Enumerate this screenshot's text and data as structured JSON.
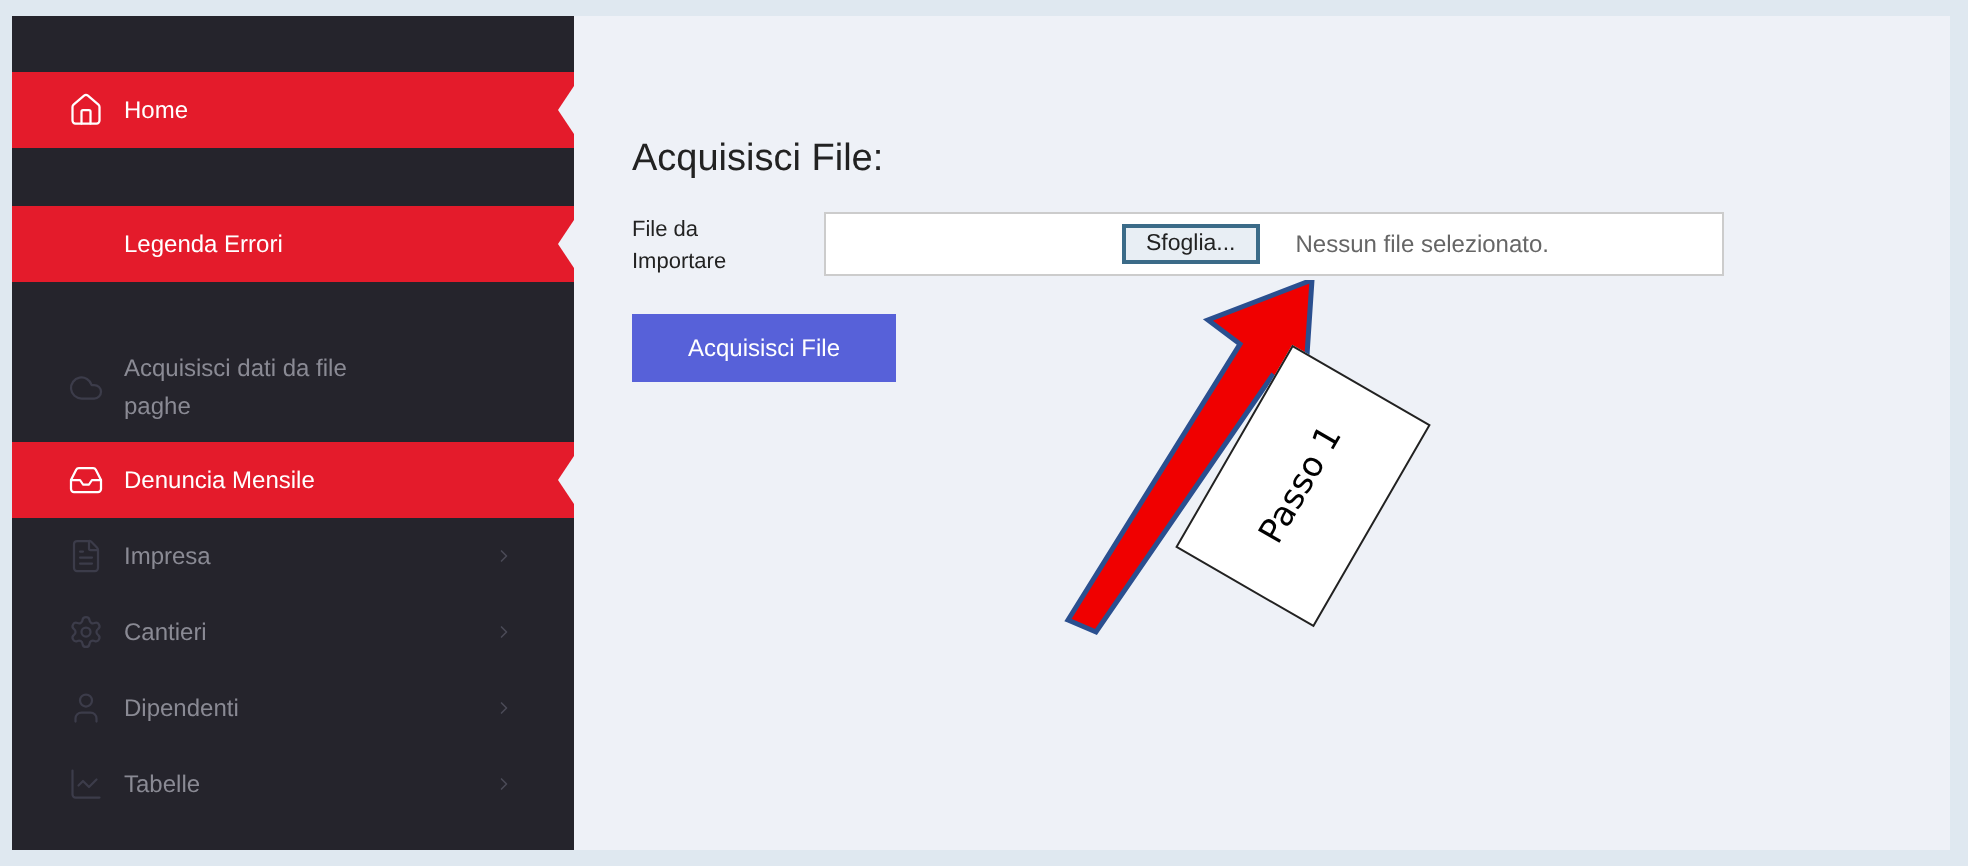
{
  "sidebar": {
    "items": [
      {
        "label": "Home",
        "highlighted": true,
        "dimmed": false,
        "has_submenu": false
      },
      {
        "label": "Legenda Errori",
        "highlighted": true,
        "dimmed": false,
        "has_submenu": false
      },
      {
        "label": "Acquisisci dati da file paghe",
        "highlighted": false,
        "dimmed": true,
        "has_submenu": false
      },
      {
        "label": "Denuncia Mensile",
        "highlighted": true,
        "dimmed": false,
        "has_submenu": false
      },
      {
        "label": "Impresa",
        "highlighted": false,
        "dimmed": true,
        "has_submenu": true
      },
      {
        "label": "Cantieri",
        "highlighted": false,
        "dimmed": true,
        "has_submenu": true
      },
      {
        "label": "Dipendenti",
        "highlighted": false,
        "dimmed": true,
        "has_submenu": true
      },
      {
        "label": "Tabelle",
        "highlighted": false,
        "dimmed": true,
        "has_submenu": true
      }
    ]
  },
  "main": {
    "title": "Acquisisci File:",
    "field_label": "File da Importare",
    "browse_button": "Sfoglia...",
    "file_status": "Nessun file selezionato.",
    "submit_button": "Acquisisci File"
  },
  "annotation": {
    "label": "Passo 1"
  }
}
